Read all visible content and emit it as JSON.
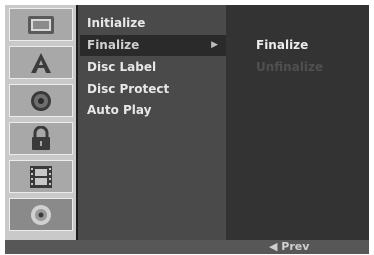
{
  "sidebar": {
    "items": [
      {
        "icon": "tv-icon"
      },
      {
        "icon": "language-a-icon"
      },
      {
        "icon": "speaker-icon"
      },
      {
        "icon": "lock-icon"
      },
      {
        "icon": "film-strip-icon"
      },
      {
        "icon": "disc-icon",
        "active": true
      }
    ]
  },
  "menu": {
    "items": [
      {
        "label": "Initialize"
      },
      {
        "label": "Finalize",
        "selected": true,
        "arrow": "▶"
      },
      {
        "label": "Disc Label"
      },
      {
        "label": "Disc Protect"
      },
      {
        "label": "Auto Play"
      }
    ]
  },
  "submenu": {
    "items": [
      {
        "label": "Finalize",
        "enabled": true
      },
      {
        "label": "Unfinalize",
        "enabled": false
      }
    ]
  },
  "footer": {
    "prev_label": "◀ Prev"
  }
}
